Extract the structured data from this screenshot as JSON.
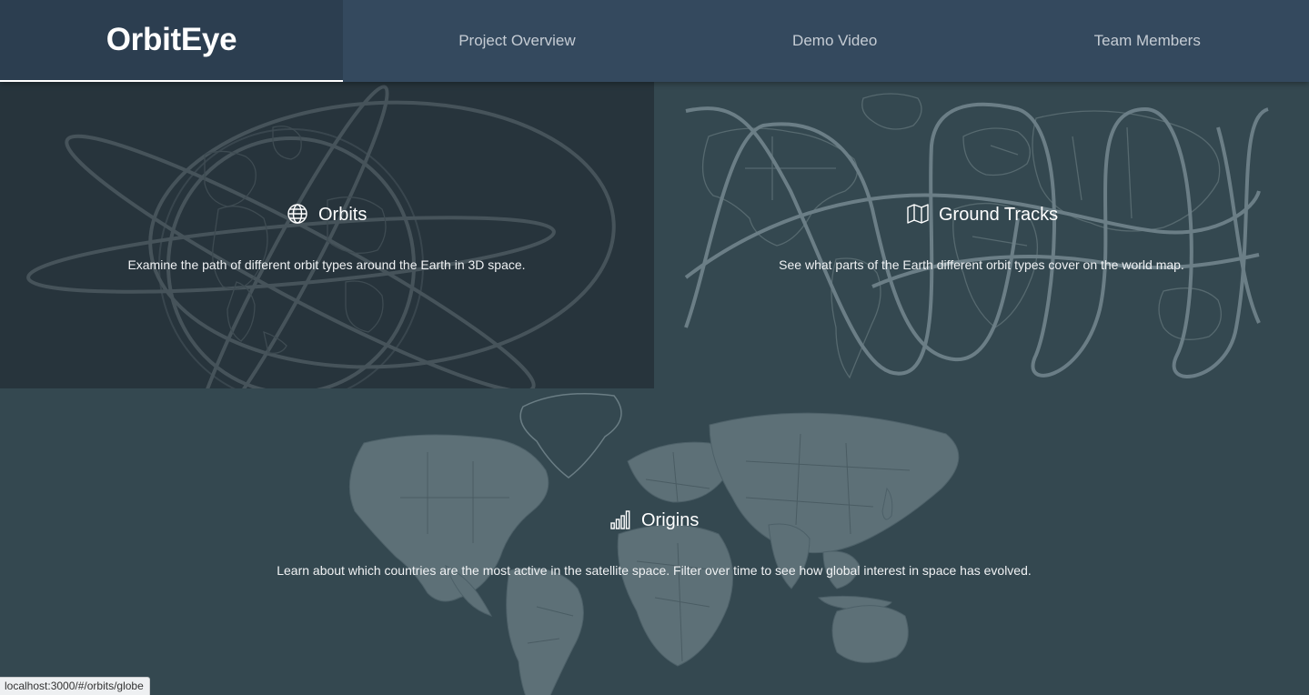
{
  "app": {
    "brand": "OrbitEye"
  },
  "nav": {
    "items": [
      {
        "label": "Project Overview"
      },
      {
        "label": "Demo Video"
      },
      {
        "label": "Team Members"
      }
    ]
  },
  "panels": {
    "orbits": {
      "title": "Orbits",
      "icon": "globe-icon",
      "description": "Examine the path of different orbit types around the Earth in 3D space."
    },
    "ground_tracks": {
      "title": "Ground Tracks",
      "icon": "map-icon",
      "description": "See what parts of the Earth different orbit types cover on the world map."
    },
    "origins": {
      "title": "Origins",
      "icon": "bar-chart-icon",
      "description": "Learn about which countries are the most active in the satellite space. Filter over time to see how global interest in space has evolved."
    }
  },
  "status": {
    "url": "localhost:3000/#/orbits/globe"
  },
  "colors": {
    "header": "#34495e",
    "brand_bg": "#2c3e50",
    "orbits_bg": "#27343c",
    "panel_bg": "#344850",
    "land": "#5d7077",
    "line": "#6c7e86"
  }
}
